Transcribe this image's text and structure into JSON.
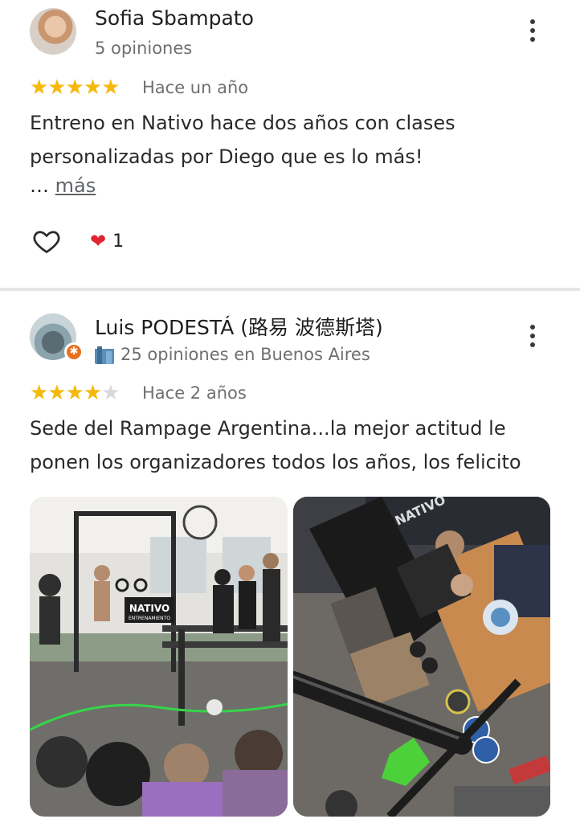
{
  "reviews": [
    {
      "name": "Sofia Sbampato",
      "sub": "5 opiniones",
      "stars": 5,
      "date": "Hace un año",
      "text": "Entreno en Nativo hace dos años con clases personalizadas por Diego que es lo más!",
      "more_prefix": "… ",
      "more_label": "más",
      "reaction_count": "1"
    },
    {
      "name": "Luis PODESTÁ (路易 波德斯塔)",
      "sub": "25 opiniones en Buenos Aires",
      "stars": 4,
      "date": "Hace 2 años",
      "text": "Sede del Rampage Argentina...la mejor actitud le ponen los organizadores todos los años, los felicito",
      "badge": "✱"
    }
  ],
  "photos": [
    {
      "sign_text": "NATIVO",
      "sign_sub": "ENTRENAMIENTO"
    },
    {
      "sign_text": "NATIVO"
    }
  ],
  "colors": {
    "star": "#f5b90b",
    "star_empty": "#d9d9d9",
    "badge": "#e8711f",
    "heart": "#e0252f"
  }
}
